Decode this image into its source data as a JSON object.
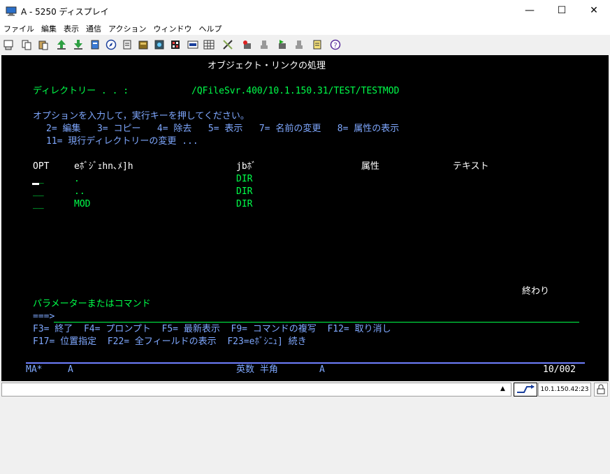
{
  "window": {
    "title": "A - 5250 ディスプレイ",
    "minimize": "—",
    "maximize": "☐",
    "close": "✕"
  },
  "menu": [
    "ファイル",
    "編集",
    "表示",
    "通信",
    "アクション",
    "ウィンドウ",
    "ヘルプ"
  ],
  "toolbar_icons": [
    "print-screen-icon",
    "copy-icon",
    "paste-icon",
    "send-file-icon",
    "receive-file-icon",
    "display-file-icon",
    "navigator-icon",
    "macro-icon",
    "record-macro-icon",
    "play-macro-icon",
    "keypad-icon",
    "color-map-icon",
    "key-map-icon",
    "customize-icon",
    "record-stop-icon",
    "pause-icon",
    "play-icon",
    "stop-icon",
    "notes-icon",
    "help-icon"
  ],
  "screen": {
    "title": "オブジェクト・リンクの処理",
    "directory_label": "ディレクトリー . . :",
    "directory_value": "/QFileSvr.400/10.1.150.31/TEST/TESTMOD",
    "instructions": "オプションを入力して，実行キーを押してください。",
    "options_line1": "2= 編集   3= コピー   4= 除去   5= 表示   7= 名前の変更   8= 属性の表示",
    "options_line2": "11= 現行ディレクトリーの変更 ...",
    "headers": {
      "opt": "OPT",
      "object_link": "eﾎﾞｼﾞｪhn､ﾒ]h",
      "type": "jbﾎﾞ",
      "attribute": "属性",
      "text": "テキスト"
    },
    "rows": [
      {
        "opt": "__",
        "name": ".",
        "type": "DIR"
      },
      {
        "opt": "__",
        "name": "..",
        "type": "DIR"
      },
      {
        "opt": "__",
        "name": "MOD",
        "type": "DIR"
      }
    ],
    "end_marker": "終わり",
    "param_label": "パラメーターまたはコマンド",
    "prompt": "===>",
    "fkeys_line1": "F3= 終了  F4= プロンプト  F5= 最新表示  F9= コマンドの複写  F12= 取り消し",
    "fkeys_line2": "F17= 位置指定  F22= 全フィールドの表示  F23=eﾎﾞｼﾆｭ] 続き",
    "status_left": "MA*",
    "status_session": "A",
    "status_mode": "英数 半角",
    "status_session2": "A",
    "status_cursor": "10/002"
  },
  "statusbar": {
    "ip": "10.1.150.42:23"
  }
}
